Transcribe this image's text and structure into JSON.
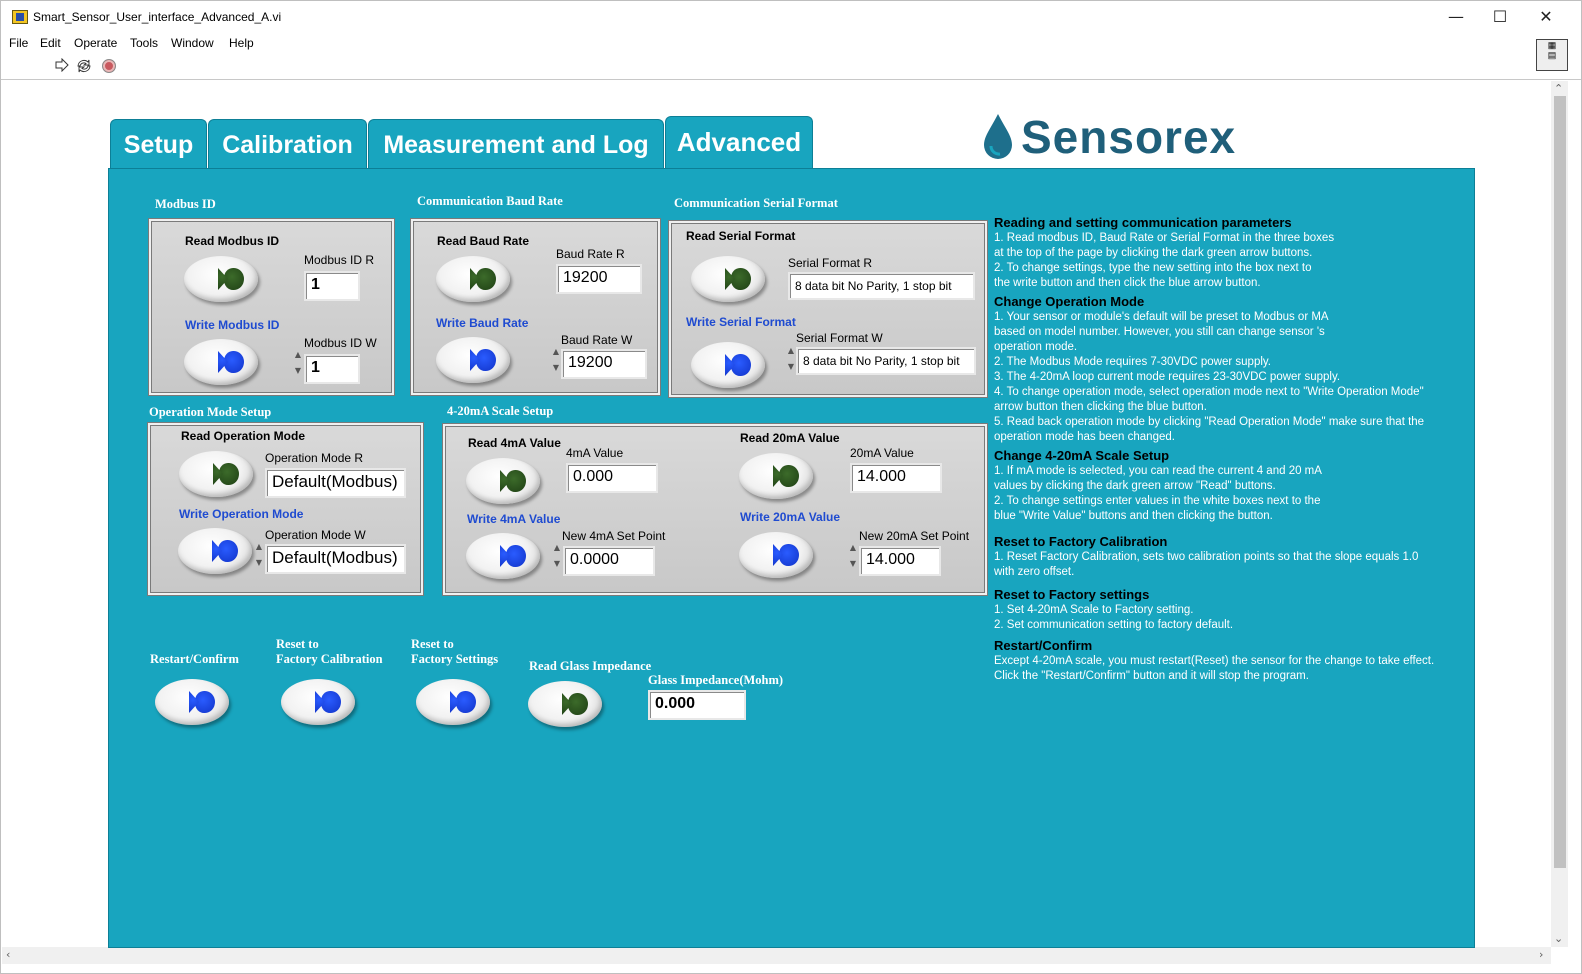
{
  "window": {
    "title": "Smart_Sensor_User_interface_Advanced_A.vi",
    "minimize": "—",
    "maximize": "☐",
    "close": "✕"
  },
  "menu": [
    "File",
    "Edit",
    "Operate",
    "Tools",
    "Window",
    "Help"
  ],
  "tabs": [
    "Setup",
    "Calibration",
    "Measurement and Log",
    "Advanced"
  ],
  "active_tab": "Advanced",
  "logo": "Sensorex",
  "modbus": {
    "group": "Modbus ID",
    "read_label": "Read Modbus ID",
    "write_label": "Write Modbus ID",
    "r_label": "Modbus  ID R",
    "r_value": "1",
    "w_label": "Modbus  ID W",
    "w_value": "1"
  },
  "baud": {
    "group": "Communication Baud Rate",
    "read_label": "Read Baud Rate",
    "write_label": "Write Baud Rate",
    "r_label": "Baud Rate R",
    "r_value": "19200",
    "w_label": "Baud Rate W",
    "w_value": "19200"
  },
  "serial": {
    "group": "Communication Serial Format",
    "read_label": "Read Serial Format",
    "write_label": "Write Serial Format",
    "r_label": "Serial Format R",
    "r_value": "8 data bit No Parity, 1 stop bit",
    "w_label": "Serial Format W",
    "w_value": "8 data bit No Parity, 1 stop bit"
  },
  "opmode": {
    "group": "Operation Mode Setup",
    "read_label": "Read Operation Mode",
    "write_label": "Write Operation Mode",
    "r_label": "Operation Mode R",
    "r_value": "Default(Modbus)",
    "w_label": "Operation Mode W",
    "w_value": "Default(Modbus)"
  },
  "scale": {
    "group": "4-20mA Scale Setup",
    "read4_label": "Read 4mA Value",
    "write4_label": "Write 4mA Value",
    "v4_label": "4mA Value",
    "v4_value": "0.000",
    "new4_label": "New 4mA Set Point",
    "new4_value": "0.0000",
    "read20_label": "Read 20mA Value",
    "write20_label": "Write 20mA Value",
    "v20_label": "20mA Value",
    "v20_value": "14.000",
    "new20_label": "New 20mA Set Point",
    "new20_value": "14.000"
  },
  "bottom": {
    "restart_label": "Restart/Confirm",
    "reset_cal_label_1": "Reset to",
    "reset_cal_label_2": "Factory Calibration",
    "reset_set_label_1": "Reset to",
    "reset_set_label_2": "Factory Settings",
    "glass_read_label": "Read Glass Impedance",
    "glass_label": "Glass Impedance(Mohm)",
    "glass_value": "0.000"
  },
  "help": {
    "h1": "Reading and setting communication parameters",
    "h1_lines": [
      "1. Read modbus ID, Baud Rate or Serial Format in the three boxes",
      "    at the top of the page by clicking the dark green arrow buttons.",
      "2. To change settings, type the new setting into the box next to",
      "    the write button and then click the blue arrow button."
    ],
    "h2": "Change Operation Mode",
    "h2_lines": [
      "1. Your sensor or module's default will be preset to Modbus or MA",
      "     based on model number.  However, you still can change sensor 's",
      "     operation mode.",
      "2. The Modbus Mode requires 7-30VDC power supply.",
      "3. The 4-20mA loop current mode requires 23-30VDC power supply.",
      "4. To change operation mode, select operation mode next to \"Write Operation Mode\"",
      "    arrow button then clicking the blue button.",
      "5. Read back operation mode by clicking \"Read Operation Mode\" make sure that the",
      "    operation mode has been changed."
    ],
    "h3": "Change 4-20mA Scale Setup",
    "h3_lines": [
      "1. If mA mode is selected, you can read the current 4 and 20 mA",
      "    values by clicking the dark green arrow \"Read\" buttons.",
      "2. To change settings enter values in the white boxes next to the",
      "    blue \"Write Value\" buttons and then clicking the button."
    ],
    "h4": "Reset to Factory Calibration",
    "h4_lines": [
      "1.  Reset Factory Calibration, sets two calibration points so that the slope equals 1.0",
      "     with zero offset."
    ],
    "h5": "Reset to Factory settings",
    "h5_lines": [
      "1.  Set 4-20mA Scale to Factory setting.",
      "2.  Set communication setting to factory default."
    ],
    "h6": "Restart/Confirm",
    "h6_lines": [
      " Except 4-20mA scale, you must restart(Reset) the sensor for the change to take effect.",
      " Click the \"Restart/Confirm\" button and it will stop the program."
    ]
  },
  "colors": {
    "panel": "#18a5bf",
    "write_blue": "#1f4bd0",
    "read_green": "#2d5a1e"
  }
}
